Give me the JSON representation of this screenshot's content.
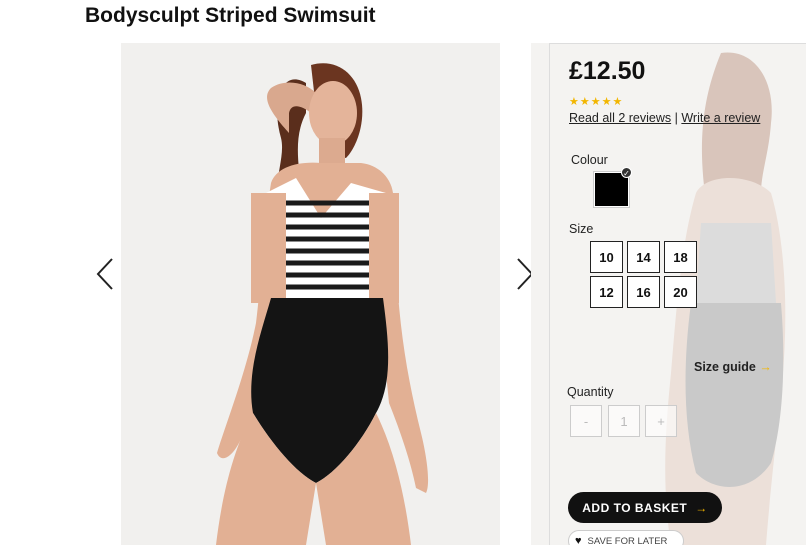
{
  "product": {
    "title": "Bodysculpt Striped Swimsuit",
    "price": "£12.50",
    "stars": "★★★★★",
    "rating": 5,
    "read_reviews": "Read all 2 reviews",
    "separator": "|",
    "write_review": "Write a review"
  },
  "options": {
    "colour_label": "Colour",
    "colour_selected_hex": "#000000",
    "size_label": "Size",
    "sizes": [
      "10",
      "14",
      "18",
      "12",
      "16",
      "20"
    ],
    "size_guide": "Size guide",
    "size_guide_arrow": "→",
    "quantity_label": "Quantity",
    "qty_minus": "-",
    "qty_value": "1",
    "qty_plus": "+"
  },
  "actions": {
    "add_to_basket": "ADD TO BASKET",
    "add_arrow": "→",
    "save_for_later": "SAVE FOR LATER"
  },
  "colors": {
    "accent": "#f2b600",
    "button": "#111111"
  }
}
